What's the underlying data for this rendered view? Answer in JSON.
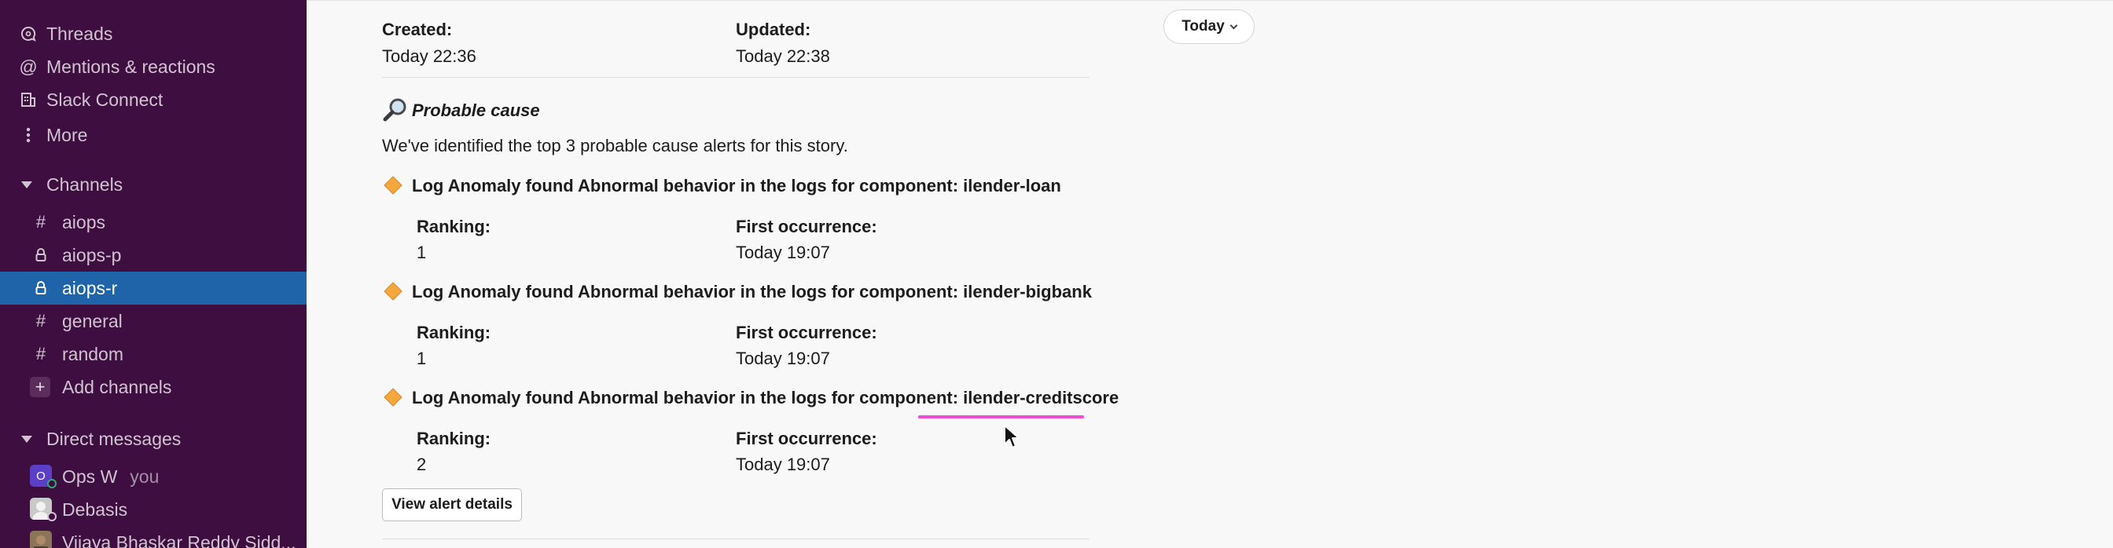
{
  "sidebar": {
    "nav": [
      {
        "label": "Threads",
        "icon": "threads-icon"
      },
      {
        "label": "Mentions & reactions",
        "icon": "at-sign-icon"
      },
      {
        "label": "Slack Connect",
        "icon": "building-icon"
      },
      {
        "label": "More",
        "icon": "more-vertical-icon"
      }
    ],
    "channels_header": "Channels",
    "channels": [
      {
        "prefix": "#",
        "label": "aiops",
        "private": false
      },
      {
        "prefix": "lock",
        "label": "aiops-p",
        "private": true
      },
      {
        "prefix": "lock",
        "label": "aiops-r",
        "private": true,
        "active": true
      },
      {
        "prefix": "#",
        "label": "general",
        "private": false
      },
      {
        "prefix": "#",
        "label": "random",
        "private": false
      }
    ],
    "add_channels": "Add channels",
    "dm_header": "Direct messages",
    "dms": [
      {
        "label": "Ops W",
        "suffix": "you",
        "avatar_letter": "O"
      },
      {
        "label": "Debasis"
      },
      {
        "label": "Vijaya Bhaskar Reddy Sidd..."
      }
    ]
  },
  "main": {
    "created_label": "Created:",
    "created_value": "Today 22:36",
    "updated_label": "Updated:",
    "updated_value": "Today 22:38",
    "date_pill": "Today",
    "probable_cause_title": "Probable cause",
    "probable_cause_icon": "magnifier-icon",
    "probable_cause_desc": "We've identified the top 3 probable cause alerts for this story.",
    "alerts": [
      {
        "title": "Log Anomaly found Abnormal behavior in the logs for component: ilender-loan",
        "ranking_label": "Ranking:",
        "ranking": "1",
        "first_label": "First occurrence:",
        "first": "Today 19:07"
      },
      {
        "title": "Log Anomaly found Abnormal behavior in the logs for component: ilender-bigbank",
        "ranking_label": "Ranking:",
        "ranking": "1",
        "first_label": "First occurrence:",
        "first": "Today 19:07"
      },
      {
        "title": "Log Anomaly found Abnormal behavior in the logs for component: ilender-creditscore",
        "ranking_label": "Ranking:",
        "ranking": "2",
        "first_label": "First occurrence:",
        "first": "Today 19:07"
      }
    ],
    "view_details_button": "View alert details"
  },
  "colors": {
    "sidebar_bg": "#3f0e40",
    "active_channel": "#1f64a8",
    "diamond": "#f4a73a",
    "highlight_underline": "#ee4bd8"
  }
}
